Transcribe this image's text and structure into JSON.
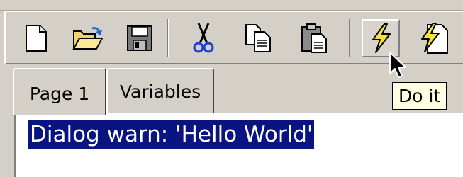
{
  "toolbar": {
    "buttons": [
      {
        "name": "new-document",
        "icon": "new-document-icon"
      },
      {
        "name": "open-folder",
        "icon": "open-folder-icon"
      },
      {
        "name": "save",
        "icon": "floppy-disk-icon"
      },
      {
        "name": "cut",
        "icon": "scissors-icon"
      },
      {
        "name": "copy",
        "icon": "copy-icon"
      },
      {
        "name": "paste",
        "icon": "clipboard-icon"
      },
      {
        "name": "do-it",
        "icon": "lightning-icon",
        "state": "hovered"
      },
      {
        "name": "print-it",
        "icon": "lightning-document-icon"
      }
    ]
  },
  "tabs": [
    {
      "label": "Page 1",
      "active": true
    },
    {
      "label": "Variables",
      "active": false
    }
  ],
  "editor": {
    "selected_text": "Dialog warn: 'Hello World'"
  },
  "tooltip": {
    "text": "Do it"
  },
  "colors": {
    "chrome": "#d4d0c8",
    "selection": "#0a1480",
    "tooltip_bg": "#ffffe1"
  }
}
